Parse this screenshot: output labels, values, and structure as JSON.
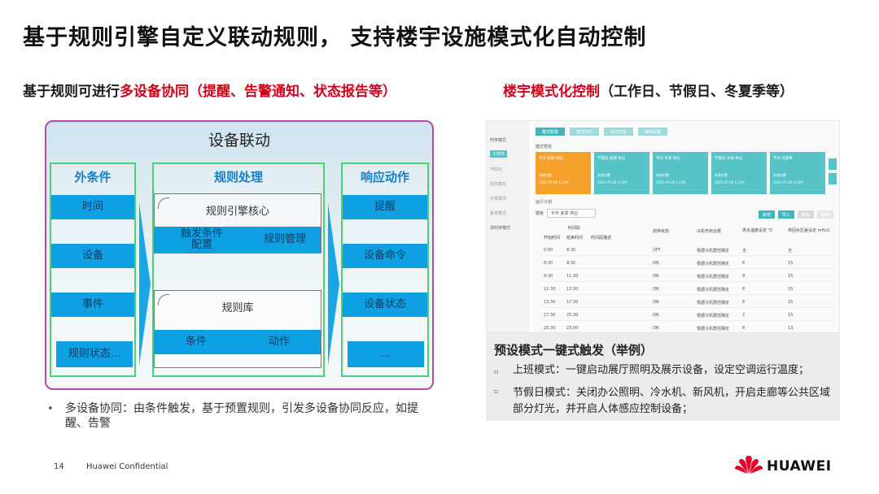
{
  "title": "基于规则引擎自定义联动规则，  支持楼宇设施模式化自动控制",
  "left_subtitle": {
    "prefix": "基于规则可进行",
    "highlight": "多设备协同（提醒、告警通知、状态报告等）"
  },
  "right_subtitle": {
    "highlight": "楼宇模式化控制",
    "suffix": "（工作日、节假日、冬夏季等）"
  },
  "diagram": {
    "title": "设备联动",
    "external": {
      "title": "外条件",
      "items": [
        "时间",
        "设备",
        "事件",
        "规则状态..."
      ]
    },
    "processing": {
      "title": "规则处理",
      "engine": {
        "title": "规则引擎核心",
        "left": "触发条件\n配置",
        "right": "规则管理"
      },
      "library": {
        "title": "规则库",
        "left": "条件",
        "right": "动作"
      }
    },
    "response": {
      "title": "响应动作",
      "items": [
        "提醒",
        "设备命令",
        "设备状态",
        "…"
      ]
    }
  },
  "bullet": "多设备协同：由条件触发，基于预置规则，引发多设备协同反应，如提醒、告警",
  "screenshot": {
    "sidebar": [
      "时序模式",
      "工作日",
      "节假日",
      "周末模式",
      "冬季模式",
      "夏季模式",
      "非时序模式"
    ],
    "tabs": [
      "模式配置",
      "模式日历",
      "操作日志",
      "策略配置"
    ],
    "section": "模式预览",
    "cards": [
      {
        "title": "平日 星期 供应",
        "status": "系统内置",
        "date": "2021-07-06 12:00"
      },
      {
        "title": "节假日 星期 供应",
        "status": "系统内置",
        "date": "2021-07-06 12:00"
      },
      {
        "title": "平日 冬季 供应",
        "status": "系统内置",
        "date": "2021-07-06 12:00"
      },
      {
        "title": "节假日 冬季 供应",
        "status": "系统内置",
        "date": "2021-07-06 12:00"
      },
      {
        "title": "平日 日夏季",
        "status": "系统内置",
        "date": "2021-07-06 12:00"
      }
    ],
    "schedule_label": "运行计划",
    "mode_label": "模板",
    "mode_value": "平日 夏季 供应",
    "buttons": [
      "新增",
      "导入",
      "删除",
      "取消"
    ],
    "headers": [
      "开始时间",
      "结束时间",
      "时间段描述",
      "启停状态",
      "冷机开启台数",
      "供水温度设定 ℃",
      "供回水压差设定 mH₂O"
    ],
    "header_group": "时间段",
    "rows": [
      [
        "0:00",
        "8:30",
        "OFF",
        "根据冷机群控确定",
        "无",
        "无"
      ],
      [
        "8:30",
        "9:30",
        "ON",
        "根据冷机群控确定",
        "6",
        "15"
      ],
      [
        "9:30",
        "11:30",
        "ON",
        "根据冷机群控确定",
        "9",
        "15"
      ],
      [
        "11:30",
        "13:30",
        "ON",
        "根据冷机群控确定",
        "8",
        "15"
      ],
      [
        "13:30",
        "17:30",
        "ON",
        "根据冷机群控确定",
        "6",
        "15"
      ],
      [
        "17:30",
        "20:30",
        "ON",
        "根据冷机群控确定",
        "7",
        "15"
      ],
      [
        "20:30",
        "23:00",
        "ON",
        "根据冷机群控确定",
        "8",
        "13"
      ]
    ]
  },
  "caption": {
    "title": "预设模式一键式触发（举例）",
    "items": [
      "上班模式：一键启动展厅照明及展示设备，设定空调运行温度；",
      "节假日模式：关闭办公照明、冷水机、新风机，开启走廊等公共区域部分灯光，并开启人体感应控制设备；"
    ]
  },
  "footer": {
    "page": "14",
    "confidential": "Huawei Confidential",
    "logo": "HUAWEI"
  },
  "colors": {
    "accent_red": "#d0021b",
    "diagram_blue": "#0ea0e3",
    "frame_green": "#4cd07a",
    "frame_purple": "#b64aa6",
    "card_teal": "#56c3c8",
    "card_orange": "#f7a12d"
  }
}
